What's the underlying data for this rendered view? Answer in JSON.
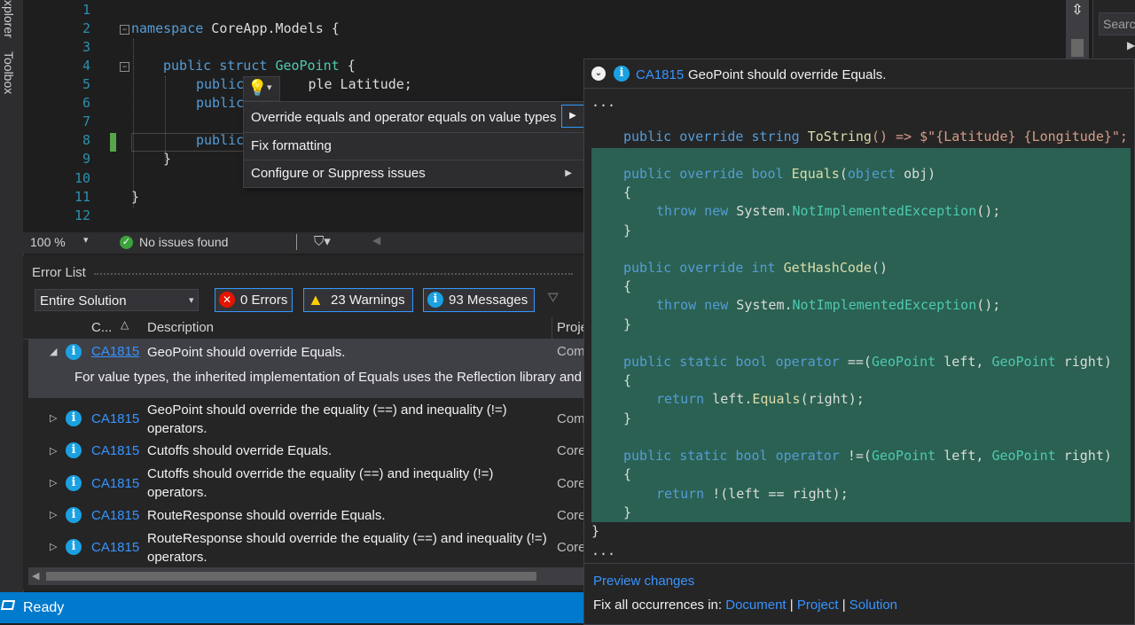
{
  "left_tabs": {
    "explorer": "xplorer",
    "toolbox": "Toolbox"
  },
  "editor": {
    "line_numbers": [
      "1",
      "2",
      "3",
      "4",
      "5",
      "6",
      "7",
      "8",
      "9",
      "10",
      "11",
      "12"
    ],
    "lines": {
      "l2_kw": "namespace",
      "l2_rest": " CoreApp.Models {",
      "l4_kw": "public struct",
      "l4_type": "GeoPoint",
      "l4_rest": " {",
      "l5_kw": "public",
      "l5_rest": "ple Latitude;",
      "l6_kw": "public",
      "l6_rest": "",
      "l8_kw": "public",
      "l9": "}",
      "l11": "}"
    },
    "zoom": "100 %",
    "issues": "No issues found"
  },
  "lightbulb_menu": {
    "items": [
      "Override equals and operator equals on value types",
      "Fix formatting",
      "Configure or Suppress issues"
    ]
  },
  "preview": {
    "code": "CA1815",
    "title": "GeoPoint should override Equals.",
    "ellipsis_top": "...",
    "tostring": {
      "kw": "public override string",
      "fn": "ToString",
      "rest": "() => $\"{Latitude} {Longitude}\";"
    },
    "equals_sig": {
      "kw": "public override bool",
      "fn": "Equals",
      "open": "(",
      "kw2": "object",
      "rest": " obj)"
    },
    "brace_open": "{",
    "brace_close": "}",
    "throw_kw": "throw new",
    "throw_ns": " System.",
    "throw_type": "NotImplementedException",
    "throw_end": "();",
    "hash_sig": {
      "kw": "public override int",
      "fn": "GetHashCode",
      "rest": "()"
    },
    "op_eq_sig": {
      "kw": "public static bool operator",
      "op": " ==(",
      "t1": "GeoPoint",
      "a1": " left, ",
      "t2": "GeoPoint",
      "a2": " right)"
    },
    "op_eq_body": {
      "kw": "return",
      "mid": " left.",
      "fn": "Equals",
      "end": "(right);"
    },
    "op_ne_sig": {
      "kw": "public static bool operator",
      "op": " !=(",
      "t1": "GeoPoint",
      "a1": " left, ",
      "t2": "GeoPoint",
      "a2": " right)"
    },
    "op_ne_body": {
      "kw": "return",
      "end": " !(left == right);"
    },
    "ellipsis_bottom": "...",
    "preview_changes": "Preview changes",
    "fix_all_label": "Fix all occurrences in:",
    "fix_document": "Document",
    "fix_project": "Project",
    "fix_solution": "Solution"
  },
  "error_list": {
    "title": "Error List",
    "scope": "Entire Solution",
    "errors": "0 Errors",
    "warnings": "23 Warnings",
    "messages": "93 Messages",
    "col_code": "C...",
    "col_desc": "Description",
    "col_proj": "Proje",
    "expanded_detail": "For value types, the inherited implementation of Equals uses the Reflection library and c",
    "rows": [
      {
        "code": "CA1815",
        "desc1": "GeoPoint should override Equals.",
        "desc2": "",
        "proj": "Com"
      },
      {
        "code": "CA1815",
        "desc1": "GeoPoint should override the equality (==) and inequality (!=)",
        "desc2": "operators.",
        "proj": "Com"
      },
      {
        "code": "CA1815",
        "desc1": "Cutoffs should override Equals.",
        "desc2": "",
        "proj": "Core"
      },
      {
        "code": "CA1815",
        "desc1": "Cutoffs should override the equality (==) and inequality (!=)",
        "desc2": "operators.",
        "proj": "Core"
      },
      {
        "code": "CA1815",
        "desc1": "RouteResponse should override Equals.",
        "desc2": "",
        "proj": "Core"
      },
      {
        "code": "CA1815",
        "desc1": "RouteResponse should override the equality (==) and inequality (!=)",
        "desc2": "operators.",
        "proj": "Core"
      }
    ]
  },
  "search": {
    "placeholder": "Search"
  },
  "status": {
    "text": "Ready"
  },
  "colors": {
    "accent": "#007acc",
    "preview_highlight": "#2a6152",
    "info": "#1ba1e2",
    "error": "#e51400",
    "warning": "#ffcc00"
  }
}
